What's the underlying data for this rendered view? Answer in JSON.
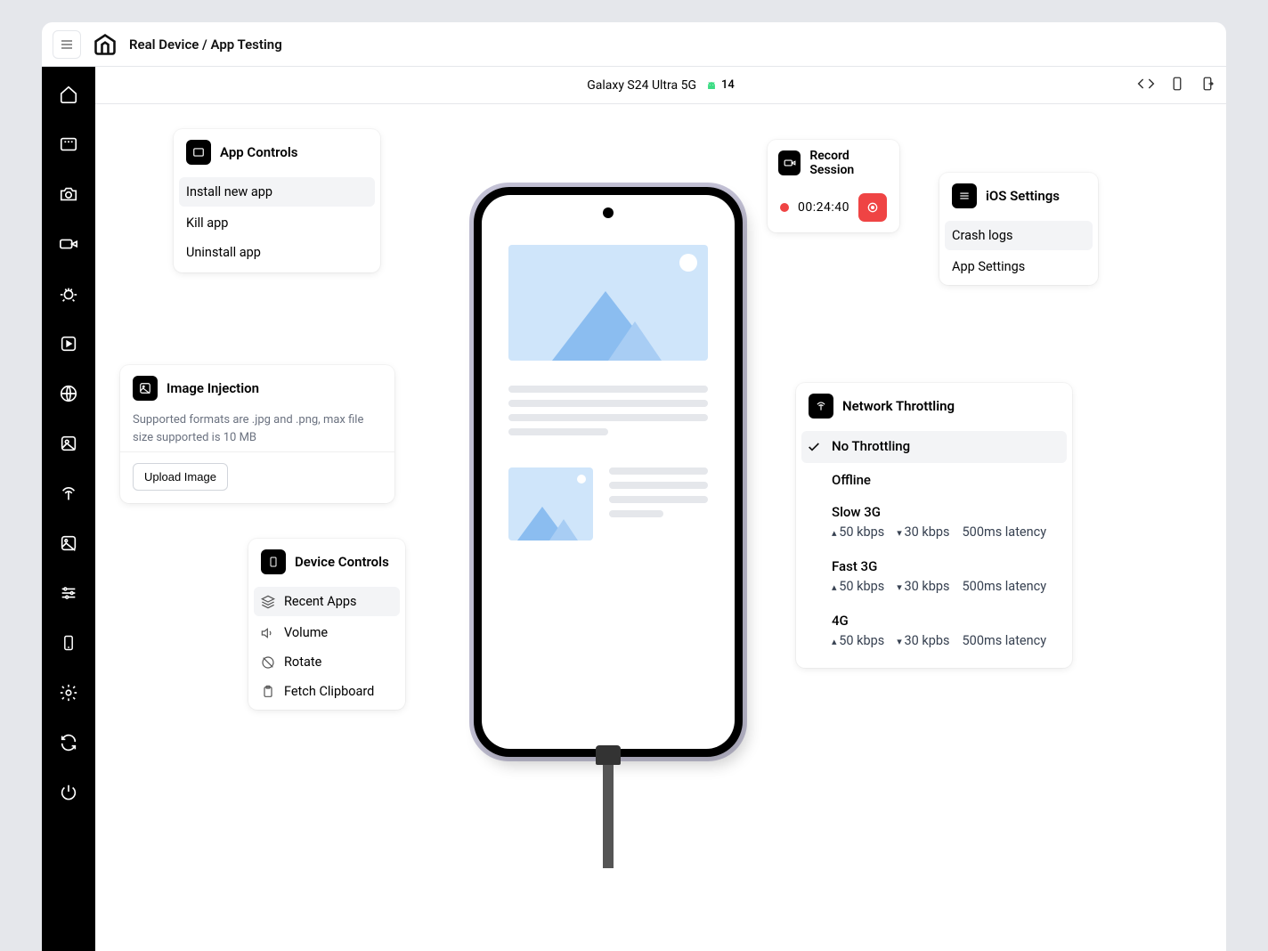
{
  "breadcrumb": "Real Device / App Testing",
  "device": {
    "name": "Galaxy S24 Ultra 5G",
    "os_version": "14"
  },
  "app_controls": {
    "title": "App Controls",
    "items": [
      "Install new app",
      "Kill app",
      "Uninstall app"
    ]
  },
  "image_injection": {
    "title": "Image Injection",
    "subtext": "Supported formats are .jpg and .png, max file size supported is 10 MB",
    "button": "Upload Image"
  },
  "device_controls": {
    "title": "Device Controls",
    "items": [
      "Recent Apps",
      "Volume",
      "Rotate",
      "Fetch Clipboard"
    ]
  },
  "record": {
    "title": "Record Session",
    "time": "00:24:40"
  },
  "ios_settings": {
    "title": "iOS Settings",
    "items": [
      "Crash logs",
      "App Settings"
    ]
  },
  "network": {
    "title": "Network Throttling",
    "options": [
      {
        "name": "No Throttling",
        "selected": true
      },
      {
        "name": "Offline"
      },
      {
        "name": "Slow 3G",
        "up": "50 kbps",
        "down": "30 kbps",
        "latency": "500ms latency"
      },
      {
        "name": "Fast 3G",
        "up": "50 kbps",
        "down": "30 kbps",
        "latency": "500ms latency"
      },
      {
        "name": "4G",
        "up": "50 kbps",
        "down": "30 kpbs",
        "latency": "500ms latency"
      }
    ]
  }
}
